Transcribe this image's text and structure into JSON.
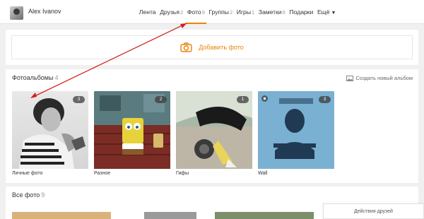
{
  "header": {
    "username": "Alex Ivanov",
    "nav": [
      {
        "label": "Лента",
        "count": ""
      },
      {
        "label": "Друзья",
        "count": "2"
      },
      {
        "label": "Фото",
        "count": "9"
      },
      {
        "label": "Группы",
        "count": "2"
      },
      {
        "label": "Игры",
        "count": "1"
      },
      {
        "label": "Заметки",
        "count": "6"
      },
      {
        "label": "Подарки",
        "count": ""
      },
      {
        "label": "Ещё",
        "count": ""
      }
    ],
    "more_caret": "▼",
    "active_tab": "Фото"
  },
  "add_photo": {
    "label": "Добавить фото"
  },
  "albums": {
    "title": "Фотоальбомы",
    "count": "4",
    "create_label": "Создать новый альбом",
    "items": [
      {
        "label": "Личные фото",
        "count": "3"
      },
      {
        "label": "Разное",
        "count": "2"
      },
      {
        "label": "Гифы",
        "count": "1"
      },
      {
        "label": "Wall",
        "count": "3"
      }
    ]
  },
  "all_photos": {
    "title": "Все фото",
    "count": "9"
  },
  "friends_panel": {
    "label": "Действия друзей"
  },
  "colors": {
    "accent": "#ee8208",
    "annotation_arrow": "#d0211c"
  }
}
